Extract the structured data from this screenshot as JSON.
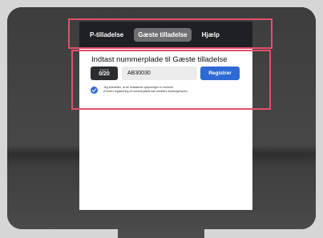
{
  "tabs": [
    {
      "label": "P-tilladelse",
      "active": false
    },
    {
      "label": "Gæste tilladelse",
      "active": true
    },
    {
      "label": "Hjælp",
      "active": false
    }
  ],
  "form": {
    "title": "Indtast nummerplade til Gæste tilladelse",
    "counter_label": "anvendt",
    "counter_value": "0/20",
    "plate_value": "AB30030",
    "register_label": "Registrer",
    "confirm_line1": "Jeg bekræfter, at de indtastede oplysninger er korrekte.",
    "confirm_line2": "(Forkert registrering af nummerplade kan medføre kontrolgebyrer)",
    "confirm_checked": true
  },
  "colors": {
    "accent": "#2d6ad6",
    "highlight": "#e3506a",
    "tabbar": "#1f2025",
    "active_tab": "#6f6f73"
  },
  "icons": {
    "checkbox": "check-icon"
  }
}
